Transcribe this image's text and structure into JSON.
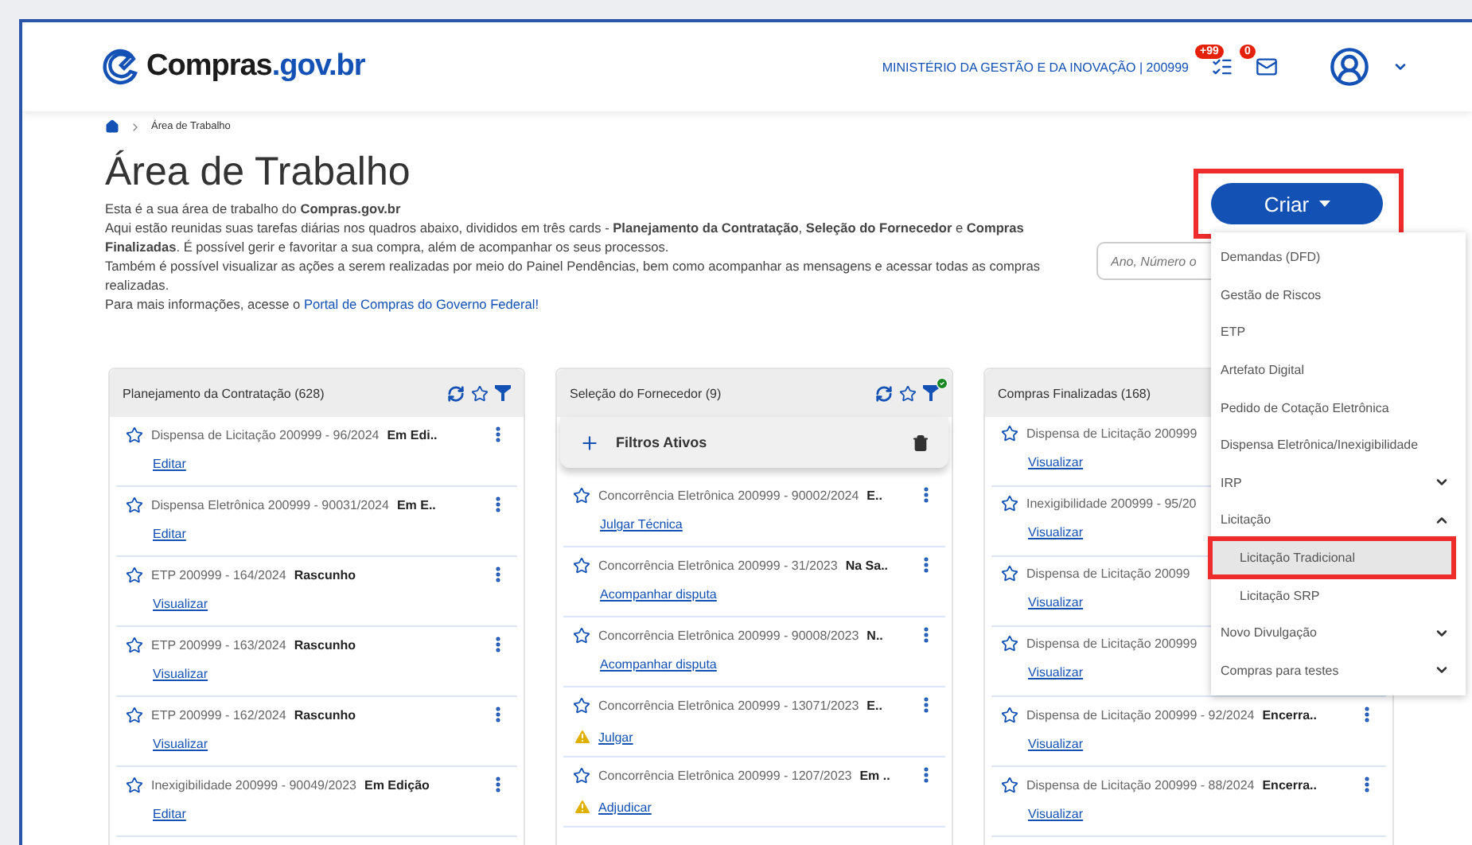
{
  "header": {
    "logo": {
      "name": "Compras",
      "suffix": ".gov.br"
    },
    "org": "MINISTÉRIO DA GESTÃO E DA INOVAÇÃO | 200999",
    "notifications_badge": "+99",
    "messages_badge": "0"
  },
  "breadcrumb": [
    "Área de Trabalho"
  ],
  "page": {
    "title": "Área de Trabalho",
    "intro": [
      "Esta é a sua área de trabalho do **Compras.gov.br**",
      "Aqui estão reunidas suas tarefas diárias nos quadros abaixo, divididos em três cards - **Planejamento da Contratação**, **Seleção do Fornecedor** e **Compras Finalizadas**. É possível gerir e favoritar a sua compra, além de acompanhar os seus processos.",
      "Também é possível visualizar as ações a serem realizadas por meio do Painel Pendências, bem como acompanhar as mensagens e acessar todas as compras realizadas."
    ],
    "more_info": "Para mais informações, acesse o ",
    "more_info_link": "Portal de Compras do Governo Federal!"
  },
  "create": {
    "label": "Criar",
    "highlighted": true
  },
  "search": {
    "placeholder": "Ano, Número o"
  },
  "create_menu": [
    {
      "label": "Demandas (DFD)",
      "kind": "item"
    },
    {
      "label": "Gestão de Riscos",
      "kind": "item"
    },
    {
      "label": "ETP",
      "kind": "item"
    },
    {
      "label": "Artefato Digital",
      "kind": "item"
    },
    {
      "label": "Pedido de Cotação Eletrônica",
      "kind": "item"
    },
    {
      "label": "Dispensa Eletrônica/Inexigibilidade",
      "kind": "item"
    },
    {
      "label": "IRP",
      "kind": "group",
      "expanded": false
    },
    {
      "label": "Licitação",
      "kind": "group",
      "expanded": true,
      "children": [
        {
          "label": "Licitação Tradicional",
          "selected": true,
          "highlighted": true
        },
        {
          "label": "Licitação SRP",
          "selected": false,
          "highlighted": false
        }
      ]
    },
    {
      "label": "Novo Divulgação",
      "kind": "group",
      "expanded": false
    },
    {
      "label": "Compras para testes",
      "kind": "group",
      "expanded": false
    }
  ],
  "cards": [
    {
      "title": "Planejamento da Contratação (628)",
      "header_tools": true,
      "items": [
        {
          "title": "Dispensa de Licitação 200999 - 96/2024",
          "status": "Em Edi..",
          "action": "Editar",
          "warning": false
        },
        {
          "title": "Dispensa Eletrônica 200999 - 90031/2024",
          "status": "Em E..",
          "action": "Editar",
          "warning": false
        },
        {
          "title": "ETP 200999 - 164/2024",
          "status": "Rascunho",
          "action": "Visualizar",
          "warning": false
        },
        {
          "title": "ETP 200999 - 163/2024",
          "status": "Rascunho",
          "action": "Visualizar",
          "warning": false
        },
        {
          "title": "ETP 200999 - 162/2024",
          "status": "Rascunho",
          "action": "Visualizar",
          "warning": false
        },
        {
          "title": "Inexigibilidade 200999 - 90049/2023",
          "status": "Em Edição",
          "action": "Editar",
          "warning": false
        }
      ]
    },
    {
      "title": "Seleção do Fornecedor (9)",
      "header_tools": true,
      "filter_active": true,
      "filter_panel": "Filtros Ativos",
      "items": [
        {
          "title": "Concorrência Eletrônica 200999 - 90002/2024",
          "status": "E..",
          "action": "Julgar Técnica",
          "warning": false
        },
        {
          "title": "Concorrência Eletrônica 200999 - 31/2023",
          "status": "Na Sa..",
          "action": "Acompanhar disputa",
          "warning": false
        },
        {
          "title": "Concorrência Eletrônica 200999 - 90008/2023",
          "status": "N..",
          "action": "Acompanhar disputa",
          "warning": false
        },
        {
          "title": "Concorrência Eletrônica 200999 - 13071/2023",
          "status": "E..",
          "action": "Julgar",
          "warning": true
        },
        {
          "title": "Concorrência Eletrônica 200999 - 1207/2023",
          "status": "Em ..",
          "action": "Adjudicar",
          "warning": true
        }
      ]
    },
    {
      "title": "Compras Finalizadas (168)",
      "items": [
        {
          "title": "Dispensa de Licitação 200999",
          "action": "Visualizar",
          "warning": false
        },
        {
          "title": "Inexigibilidade 200999 - 95/20",
          "action": "Visualizar",
          "warning": false
        },
        {
          "title": "Dispensa de Licitação 20099",
          "action": "Visualizar",
          "warning": false
        },
        {
          "title": "Dispensa de Licitação 200999",
          "action": "Visualizar",
          "warning": false
        },
        {
          "title": "Dispensa de Licitação 200999 - 92/2024",
          "status": "Encerra..",
          "action": "Visualizar",
          "warning": false
        },
        {
          "title": "Dispensa de Licitação 200999 - 88/2024",
          "status": "Encerra..",
          "action": "Visualizar",
          "warning": false
        }
      ]
    }
  ]
}
